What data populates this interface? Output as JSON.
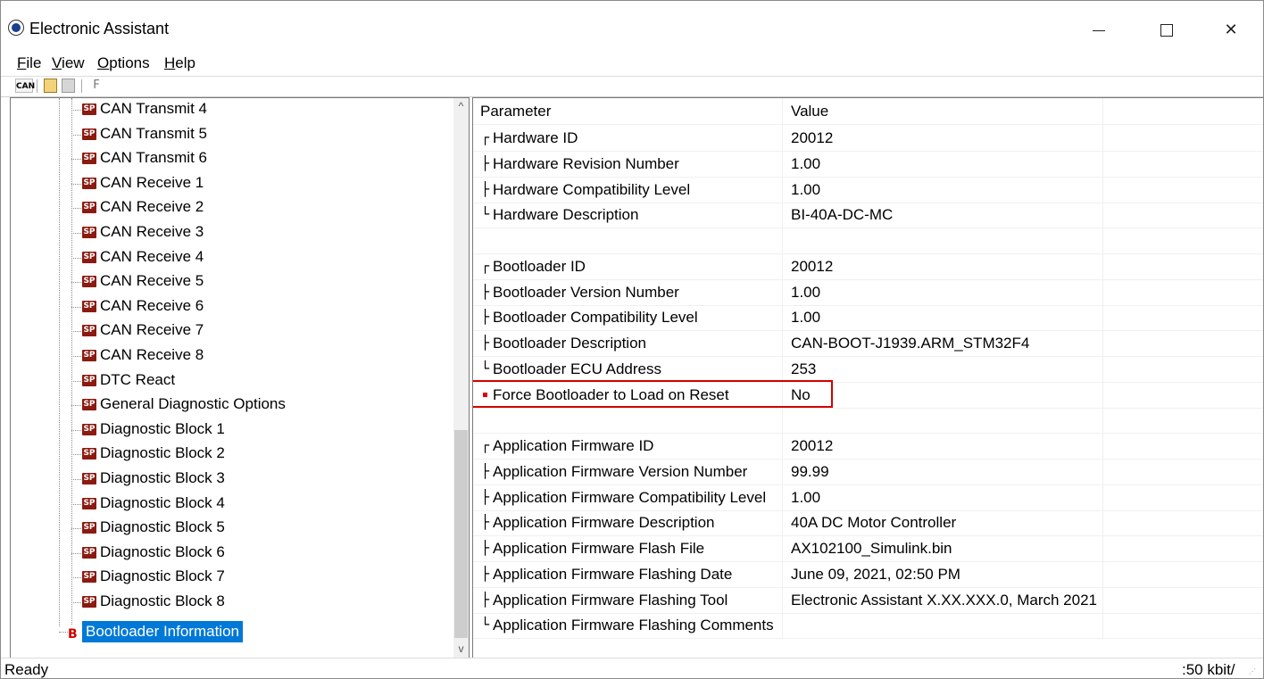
{
  "window": {
    "title": "Electronic Assistant",
    "icon": "ea-logo-icon"
  },
  "menu": [
    {
      "label": "File",
      "u": "F",
      "rest": "ile"
    },
    {
      "label": "View",
      "u": "V",
      "rest": "iew"
    },
    {
      "label": "Options",
      "u": "O",
      "rest": "ptions"
    },
    {
      "label": "Help",
      "u": "H",
      "rest": "elp"
    }
  ],
  "toolbar": {
    "can_label": "CAN",
    "f_label": "F"
  },
  "tree": {
    "items": [
      "CAN Transmit 4",
      "CAN Transmit 5",
      "CAN Transmit 6",
      "CAN Receive 1",
      "CAN Receive 2",
      "CAN Receive 3",
      "CAN Receive 4",
      "CAN Receive 5",
      "CAN Receive 6",
      "CAN Receive 7",
      "CAN Receive 8",
      "DTC React",
      "General Diagnostic Options",
      "Diagnostic Block 1",
      "Diagnostic Block 2",
      "Diagnostic Block 3",
      "Diagnostic Block 4",
      "Diagnostic Block 5",
      "Diagnostic Block 6",
      "Diagnostic Block 7",
      "Diagnostic Block 8"
    ],
    "sp_icon_label": "SP",
    "b_icon_label": "B",
    "selected": "Bootloader Information"
  },
  "params": {
    "header": {
      "name": "Parameter",
      "value": "Value"
    },
    "rows": [
      {
        "glyph": "┌",
        "name": "Hardware ID",
        "value": "20012"
      },
      {
        "glyph": "├",
        "name": "Hardware Revision Number",
        "value": "1.00"
      },
      {
        "glyph": "├",
        "name": "Hardware Compatibility Level",
        "value": "1.00"
      },
      {
        "glyph": "└",
        "name": "Hardware Description",
        "value": "BI-40A-DC-MC"
      },
      {
        "glyph": "",
        "name": "",
        "value": ""
      },
      {
        "glyph": "┌",
        "name": "Bootloader ID",
        "value": "20012"
      },
      {
        "glyph": "├",
        "name": "Bootloader Version Number",
        "value": "1.00"
      },
      {
        "glyph": "├",
        "name": "Bootloader Compatibility Level",
        "value": "1.00"
      },
      {
        "glyph": "├",
        "name": "Bootloader Description",
        "value": "CAN-BOOT-J1939.ARM_STM32F4"
      },
      {
        "glyph": "└",
        "name": "Bootloader ECU Address",
        "value": "253"
      },
      {
        "glyph": "dot",
        "name": "Force Bootloader to Load on Reset",
        "value": "No"
      },
      {
        "glyph": "",
        "name": "",
        "value": ""
      },
      {
        "glyph": "┌",
        "name": "Application Firmware ID",
        "value": "20012"
      },
      {
        "glyph": "├",
        "name": "Application Firmware Version Number",
        "value": "99.99"
      },
      {
        "glyph": "├",
        "name": "Application Firmware Compatibility Level",
        "value": "1.00"
      },
      {
        "glyph": "├",
        "name": "Application Firmware Description",
        "value": "40A DC Motor Controller"
      },
      {
        "glyph": "├",
        "name": "Application Firmware Flash File",
        "value": "AX102100_Simulink.bin"
      },
      {
        "glyph": "├",
        "name": "Application Firmware Flashing Date",
        "value": "June 09, 2021, 02:50 PM"
      },
      {
        "glyph": "├",
        "name": "Application Firmware Flashing Tool",
        "value": "Electronic Assistant X.XX.XXX.0, March 2021"
      },
      {
        "glyph": "└",
        "name": "Application Firmware Flashing Comments",
        "value": ""
      }
    ]
  },
  "status": {
    "left": "Ready",
    "right": ":50 kbit/"
  },
  "colors": {
    "selection": "#0078d7",
    "highlight_border": "#d40000",
    "sp_icon": "#8b1a10"
  }
}
